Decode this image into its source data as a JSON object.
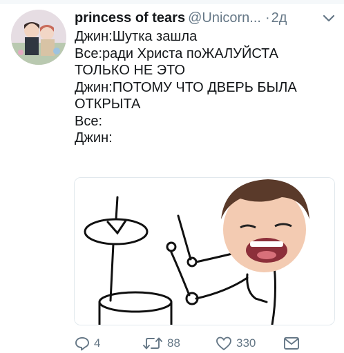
{
  "tweet": {
    "display_name": "princess of tears",
    "handle": "@Unicorn...",
    "separator": "·",
    "time": "2д",
    "lines": [
      "Джин:Шутка зашла",
      "Все:ради Христа поЖАЛУЙСТА",
      "ТОЛЬКО НЕ ЭТО",
      "Джин:ПОТОМУ ЧТО ДВЕРЬ БЫЛА",
      "ОТКРЫТА",
      "Все:",
      "Джин:"
    ]
  },
  "actions": {
    "replies": "4",
    "retweets": "88",
    "likes": "330"
  },
  "icons": {
    "reply": "reply-icon",
    "retweet": "retweet-icon",
    "like": "heart-icon",
    "dm": "envelope-icon",
    "menu": "chevron-down-icon"
  },
  "colors": {
    "text": "#14171a",
    "secondary": "#657786",
    "border": "#e1e8ed"
  }
}
